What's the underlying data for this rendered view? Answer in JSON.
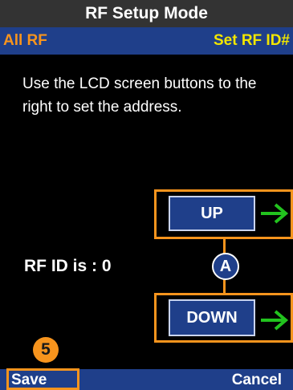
{
  "header": {
    "title": "RF Setup Mode",
    "left_label": "All RF",
    "right_label": "Set RF ID#"
  },
  "instruction": "Use the LCD screen buttons to the right to set the address.",
  "status": {
    "rf_id_text": "RF ID is : 0"
  },
  "buttons": {
    "up_label": "UP",
    "down_label": "DOWN"
  },
  "markers": {
    "a": "A",
    "five": "5"
  },
  "footer": {
    "save_label": "Save",
    "cancel_label": "Cancel"
  },
  "colors": {
    "accent_orange": "#f7941d",
    "bar_blue": "#1f3f8a",
    "arrow_green": "#22c31e",
    "header_gray": "#333333",
    "title_yellow": "#f2e600"
  },
  "icons": {
    "up_arrow": "right-arrow-icon",
    "down_arrow": "right-arrow-icon"
  }
}
